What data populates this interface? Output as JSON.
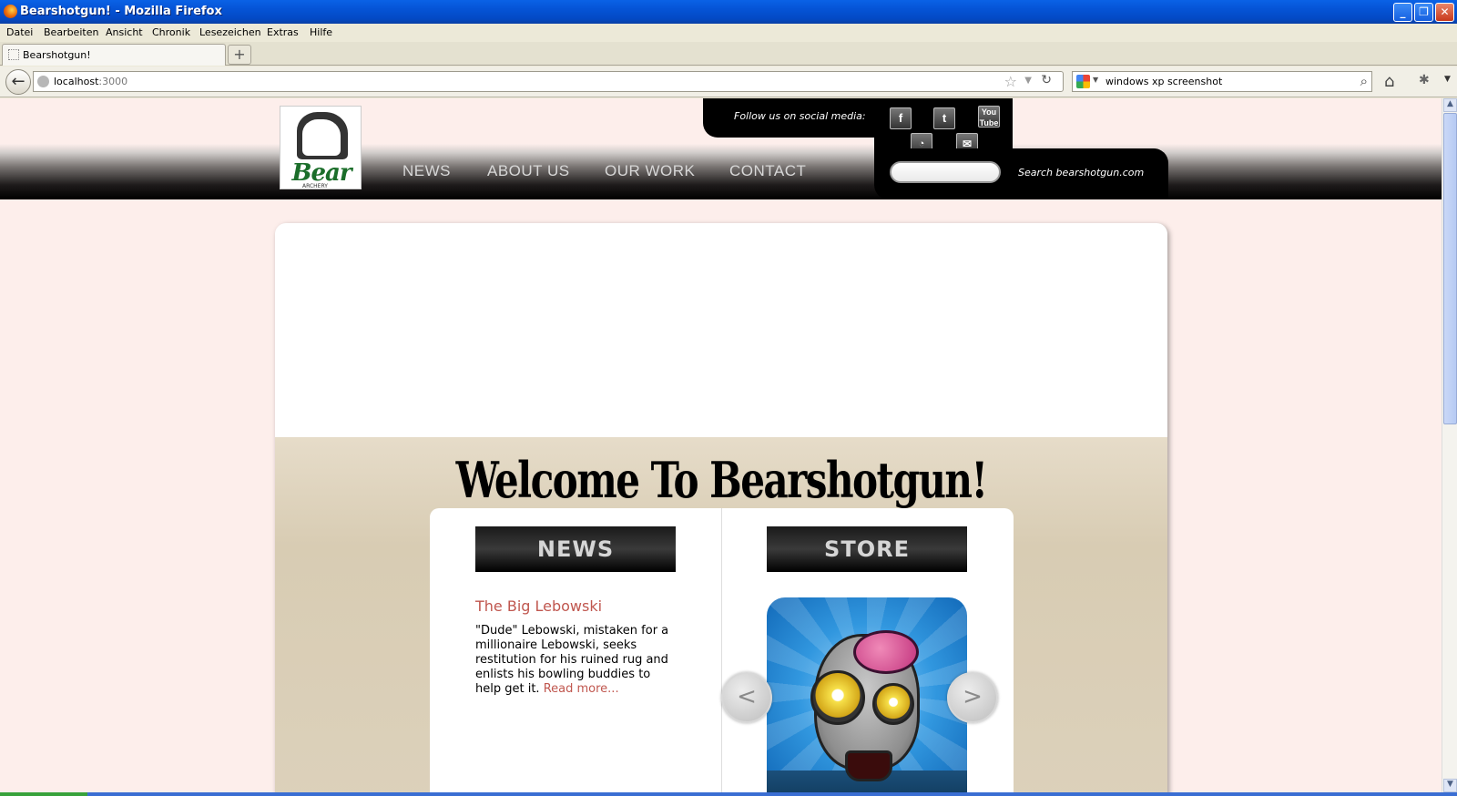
{
  "window": {
    "title": "Bearshotgun! - Mozilla Firefox"
  },
  "menu": [
    "Datei",
    "Bearbeiten",
    "Ansicht",
    "Chronik",
    "Lesezeichen",
    "Extras",
    "Hilfe"
  ],
  "tab": {
    "label": "Bearshotgun!",
    "new_tab": "+"
  },
  "nav": {
    "url_host": "localhost",
    "url_port": ":3000",
    "search_query": "windows xp screenshot"
  },
  "site": {
    "logo": {
      "word": "Bear",
      "sub": "ARCHERY"
    },
    "menu": [
      "NEWS",
      "ABOUT US",
      "OUR WORK",
      "CONTACT"
    ],
    "social_label": "Follow us on social media:",
    "social_icons": [
      "facebook-icon",
      "twitter-icon",
      "youtube-icon",
      "rss-icon",
      "email-icon"
    ],
    "search_label": "Search bearshotgun.com",
    "welcome": "Welcome To Bearshotgun!",
    "news": {
      "heading": "NEWS",
      "title": "The Big Lebowski",
      "body": "\"Dude\" Lebowski, mistaken for a millionaire Lebowski, seeks restitution for his ruined rug and enlists his bowling buddies to help get it.",
      "more": "Read more..."
    },
    "store": {
      "heading": "STORE",
      "prev": "<",
      "next": ">"
    }
  }
}
